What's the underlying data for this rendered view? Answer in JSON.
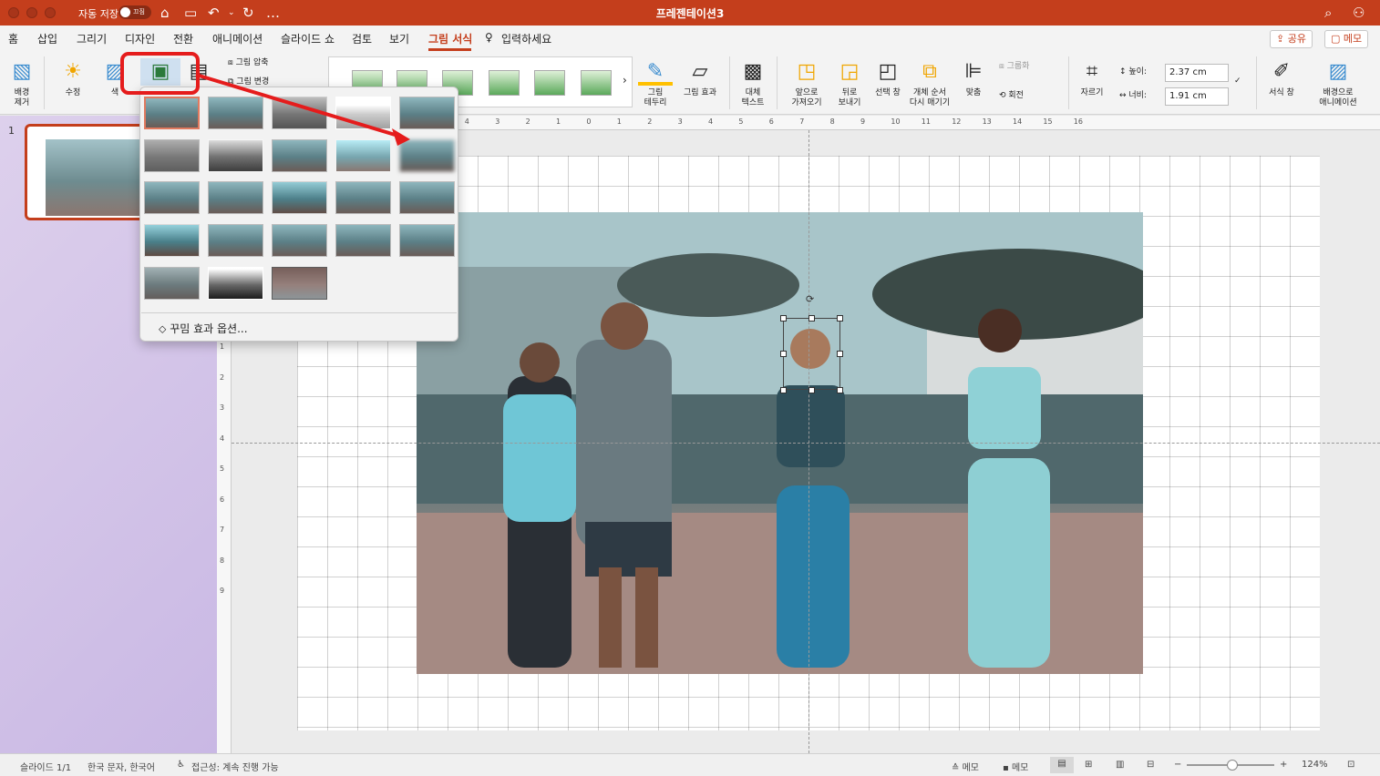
{
  "titlebar": {
    "autosave_label": "자동 저장",
    "autosave_state": "끄짐",
    "doc_title": "프레젠테이션3",
    "icons": [
      "home-icon",
      "save-icon",
      "undo-icon",
      "redo-icon",
      "more-icon",
      "search-icon",
      "share-people-icon"
    ]
  },
  "tabs": [
    "홈",
    "삽입",
    "그리기",
    "디자인",
    "전환",
    "애니메이션",
    "슬라이드 쇼",
    "검토",
    "보기",
    "그림 서식"
  ],
  "tell_me": "입력하세요",
  "top_right": {
    "share": "공유",
    "comments": "메모"
  },
  "ribbon": {
    "remove_bg": "배경\n제거",
    "corrections": "수정",
    "color": "색",
    "compress": "그림 압축",
    "change": "그림 변경",
    "border": "그림\n테두리",
    "effects": "그림 효과",
    "alt_text": "대체\n텍스트",
    "bring_forward": "앞으로\n가져오기",
    "send_backward": "뒤로\n보내기",
    "selection_pane": "선택 창",
    "reorder": "개체 순서\n다시 매기기",
    "align": "맞춤",
    "group": "그룹화",
    "rotate": "회전",
    "crop": "자르기",
    "height_label": "높이:",
    "height_value": "2.37 cm",
    "width_label": "너비:",
    "width_value": "1.91 cm",
    "format_pane": "서식 창",
    "animate_bg": "배경으로\n애니메이션"
  },
  "artistic_effects": {
    "option_label": "꾸밈 효과 옵션..."
  },
  "slide_panel": {
    "slide_number": "1"
  },
  "ruler": {
    "top": [
      "11",
      "10",
      "9",
      "8",
      "7",
      "6",
      "5",
      "4",
      "3",
      "2",
      "1",
      "0",
      "1",
      "2",
      "3",
      "4",
      "5",
      "6",
      "7",
      "8",
      "9",
      "10",
      "11",
      "12",
      "13",
      "14",
      "15",
      "16"
    ],
    "left": [
      "1",
      "2",
      "1",
      "0",
      "1",
      "2",
      "3",
      "4",
      "5",
      "6",
      "7",
      "8",
      "9"
    ]
  },
  "status": {
    "slide": "슬라이드 1/1",
    "language": "한국 문자, 한국어",
    "accessibility": "접근성: 계속 진행 가능",
    "notes": "메모",
    "comments": "메모",
    "zoom": "124%"
  },
  "colors": {
    "brand": "#c43e1c",
    "highlight": "#e51c1c"
  }
}
